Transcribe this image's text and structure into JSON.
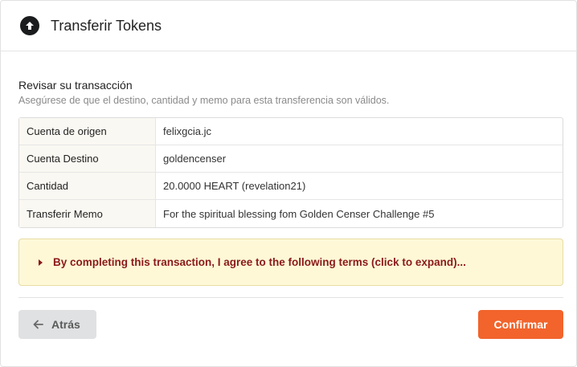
{
  "header": {
    "title": "Transferir Tokens",
    "icon": "arrow-up-circle-icon"
  },
  "review": {
    "title": "Revisar su transacción",
    "subtitle": "Asegúrese de que el destino, cantidad y memo para esta transferencia son válidos."
  },
  "transaction": {
    "rows": [
      {
        "label": "Cuenta de origen",
        "value": "felixgcia.jc"
      },
      {
        "label": "Cuenta Destino",
        "value": "goldencenser"
      },
      {
        "label": "Cantidad",
        "value": "20.0000 HEART (revelation21)"
      },
      {
        "label": "Transferir Memo",
        "value": "For the spiritual blessing fom Golden Censer Challenge #5"
      }
    ]
  },
  "terms": {
    "text": "By completing this transaction, I agree to the following terms (click to expand)...",
    "icon": "caret-right-icon"
  },
  "footer": {
    "back_label": "Atrás",
    "back_icon": "arrow-left-icon",
    "confirm_label": "Confirmar"
  },
  "colors": {
    "accent": "#f2642c",
    "terms_background": "#fef8d7",
    "terms_text": "#8b1a1a"
  }
}
